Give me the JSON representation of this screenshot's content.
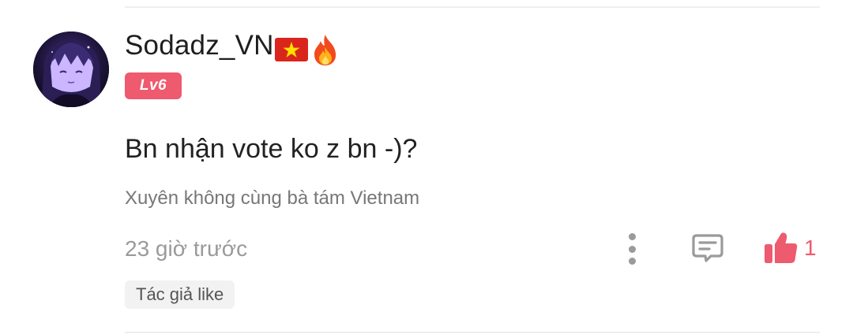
{
  "comment": {
    "username": "Sodadz_VN",
    "level_badge": "Lv6",
    "text": "Bn nhận vote ko z bn -)?",
    "story_title": "Xuyên không cùng bà tám Vietnam",
    "timestamp": "23 giờ trước",
    "like_count": "1",
    "author_like_label": "Tác giả like"
  },
  "icons": {
    "flag": "vietnam-flag-icon",
    "fire": "fire-icon",
    "more": "more-vertical-icon",
    "reply": "comment-icon",
    "like": "thumbs-up-icon"
  },
  "colors": {
    "accent": "#ee5a6e",
    "muted_text": "#9a9a9a",
    "badge_bg": "#f2f2f2",
    "flag_red": "#da251d",
    "flag_star": "#ffde00"
  }
}
